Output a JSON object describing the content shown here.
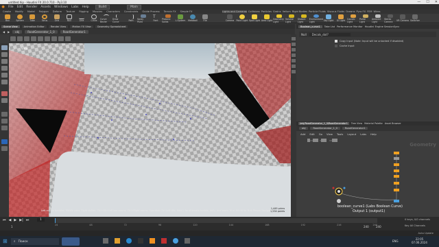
{
  "window": {
    "title": "untitled.hip - Houdini FX 20.0.710 - Py3.10",
    "controls": [
      "—",
      "☐",
      "✕"
    ]
  },
  "menubar": {
    "items": [
      "File",
      "Edit",
      "Render",
      "Assets",
      "Windows",
      "Labs",
      "Help"
    ],
    "desktop": "Build",
    "main": "Main"
  },
  "shelf_tabs_left": [
    "Create",
    "Modify",
    "Model",
    "Polygon",
    "Deform",
    "Texture",
    "Rigging",
    "Muscles",
    "Characters",
    "Constraints",
    "Guide Process",
    "Terrain FX",
    "Simple FX",
    "Volume",
    "Crowds",
    "Drive Simulation"
  ],
  "shelf_tabs_right": [
    "Lights and Cameras",
    "Collisions",
    "Particles",
    "Grains",
    "Vellum",
    "Rigid Bodies",
    "Particle Fluids",
    "Viscous Fluids",
    "Oceans",
    "Pyro FX",
    "FEM",
    "Wires",
    "Crowds",
    "Drive Simulation"
  ],
  "shelf_tools_left": [
    "Box",
    "Sphere",
    "Tube",
    "Torus",
    "Grid",
    "Null",
    "Line",
    "Circle",
    "Curve Bezier",
    "Draw Curve",
    "Path",
    "Spray Paint",
    "Font",
    "Platonic Solids",
    "L-System",
    "Metaball",
    "File",
    "Spiral",
    "Helix"
  ],
  "shelf_tools_right": [
    "Camera",
    "Point Light",
    "Spot Light",
    "Area Light",
    "Geometry Light",
    "Volume Light",
    "Distant Light",
    "Environment Light",
    "Sky Light",
    "GI Light",
    "Caustic Light",
    "Portal Light",
    "Ambient Light",
    "Stereo Camera",
    "VR Camera",
    "Switcher"
  ],
  "pane_tabs": [
    "Scene View",
    "Animation Editor",
    "Render View",
    "Motion FX View",
    "Geometry Spreadsheet"
  ],
  "path": {
    "obj": "obj",
    "node": "RoadGenerator_1_0",
    "node2": "RoadGenerator1"
  },
  "viewport": {
    "view_label": "View",
    "hint": "Left mouse tumbles. Middle pans. Right dollies. Ctrl+Alt+Left box zooms. Ctrl+Right zooms. Spacebar-Ctrl-Left tilts. Hold L for alternate tumble, dolly, and zoom.  M or Alt+M for First Person Navigation.",
    "coords": [
      "1,449  prims",
      "1,534  points"
    ]
  },
  "params": {
    "tabs": [
      "Boolean_curve1",
      "Take List",
      "Performance Monitor",
      "Houdini Engine SessionSync"
    ],
    "node_label": "Null",
    "node_name": "Decals_dot?",
    "options": [
      "Copy Input (Note: Input will be unlocked if disabled)",
      "Cache Input"
    ]
  },
  "network": {
    "tabs": [
      "/obj/RoadGenerator_1_0/RoadGenerator1",
      "Tree View",
      "Material Palette",
      "Asset Browser"
    ],
    "path_obj": "obj",
    "path_node": "RoadGenerator_1_0",
    "path_node2": "RoadGenerator1",
    "menu": [
      "Add",
      "Edit",
      "Go",
      "View",
      "Tools",
      "Layout",
      "Labs",
      "Help"
    ],
    "context_label": "Geometry",
    "selected_node": "boolean_curve1 (Labs Boolean Curve)",
    "output_label": "Output 1 (output1)"
  },
  "timeline": {
    "frame": "1",
    "start": "1",
    "end": "240",
    "end2": "240",
    "ticks": [
      "24",
      "48",
      "72",
      "96",
      "120",
      "144",
      "168",
      "192",
      "216",
      "240"
    ]
  },
  "status": {
    "keys": "0 keys, 0/0 channels",
    "key_all": "Key All Channels",
    "auto_update": "Auto Update"
  },
  "taskbar": {
    "search_placeholder": "Поиск",
    "time": "22:05",
    "date": "07.06.2024",
    "lang": "ENG"
  },
  "colors": {
    "accent": "#f0a020",
    "highlight": "#ffd24d",
    "sky": "#9fb5c1",
    "red": "#b01818"
  }
}
